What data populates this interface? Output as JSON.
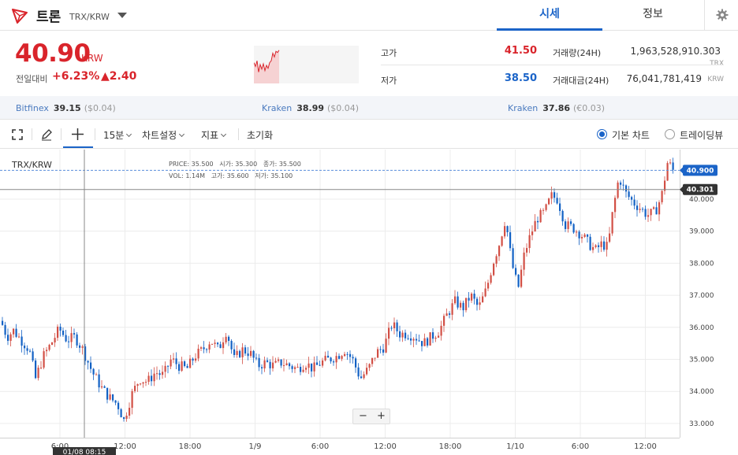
{
  "header": {
    "coin_name": "트론",
    "pair": "TRX/KRW",
    "tabs": [
      {
        "label": "시세",
        "active": true
      },
      {
        "label": "정보",
        "active": false
      }
    ]
  },
  "summary": {
    "price": "40.90",
    "unit": "KRW",
    "change_label": "전일대비",
    "change_rate": "+6.23%",
    "change_amount": "▲2.40",
    "high_label": "고가",
    "high": "41.50",
    "low_label": "저가",
    "low": "38.50",
    "volume_label": "거래량(24H)",
    "volume": "1,963,528,910.303",
    "volume_unit": "TRX",
    "value_label": "거래대금(24H)",
    "value": "76,041,781,419",
    "value_unit": "KRW"
  },
  "exchanges": [
    {
      "name": "Bitfinex",
      "price": "39.15",
      "sub": "($0.04)"
    },
    {
      "name": "Kraken",
      "price": "38.99",
      "sub": "($0.04)"
    },
    {
      "name": "Kraken",
      "price": "37.86",
      "sub": "(€0.03)"
    }
  ],
  "toolbar": {
    "interval": "15분",
    "settings": "차트설정",
    "indicators": "지표",
    "reset": "초기화",
    "basic_chart": "기본 차트",
    "tradingview": "트레이딩뷰"
  },
  "chart": {
    "pair_label": "TRX/KRW",
    "ohlc_row1": [
      "PRICE:",
      "35.500",
      "시가:",
      "35.300",
      "종가:",
      "35.500"
    ],
    "ohlc_row2": [
      "VOL:",
      "1.14M",
      "고가:",
      "35.600",
      "저가:",
      "35.100"
    ],
    "current_price_tag": "40.900",
    "crosshair_price_tag": "40.301",
    "crosshair_time_tag": "01/08 08:15",
    "zoom_out": "−",
    "zoom_in": "+",
    "colors": {
      "up": "#d24f45",
      "down": "#1261c4",
      "accent": "#1b64c8"
    }
  },
  "chart_data": {
    "type": "candlestick",
    "y_ticks": [
      "33.000",
      "34.000",
      "35.000",
      "36.000",
      "37.000",
      "38.000",
      "39.000",
      "40.000"
    ],
    "ylim": [
      32.85,
      41.35
    ],
    "x_ticks": [
      "6:00",
      "12:00",
      "18:00",
      "1/9",
      "6:00",
      "12:00",
      "18:00",
      "1/10",
      "6:00",
      "12:00"
    ],
    "current_price": 40.9,
    "crosshair_price": 40.301,
    "close_path": [
      [
        0,
        36.2
      ],
      [
        8,
        35.7
      ],
      [
        16,
        35.9
      ],
      [
        26,
        35.6
      ],
      [
        36,
        35.3
      ],
      [
        44,
        34.4
      ],
      [
        54,
        35.1
      ],
      [
        64,
        35.5
      ],
      [
        74,
        35.95
      ],
      [
        84,
        35.6
      ],
      [
        94,
        35.7
      ],
      [
        104,
        35.3
      ],
      [
        116,
        34.6
      ],
      [
        128,
        34.1
      ],
      [
        138,
        33.8
      ],
      [
        148,
        33.6
      ],
      [
        156,
        33.1
      ],
      [
        166,
        33.9
      ],
      [
        176,
        34.4
      ],
      [
        186,
        34.3
      ],
      [
        196,
        34.6
      ],
      [
        206,
        34.5
      ],
      [
        216,
        35.0
      ],
      [
        226,
        34.8
      ],
      [
        236,
        34.7
      ],
      [
        246,
        35.1
      ],
      [
        256,
        35.3
      ],
      [
        266,
        35.6
      ],
      [
        276,
        35.3
      ],
      [
        286,
        35.9
      ],
      [
        296,
        35.0
      ],
      [
        306,
        35.3
      ],
      [
        316,
        35.2
      ],
      [
        326,
        34.8
      ],
      [
        336,
        34.9
      ],
      [
        346,
        34.8
      ],
      [
        356,
        34.9
      ],
      [
        366,
        34.8
      ],
      [
        376,
        34.7
      ],
      [
        386,
        34.9
      ],
      [
        396,
        34.7
      ],
      [
        406,
        34.9
      ],
      [
        416,
        35.0
      ],
      [
        426,
        35.1
      ],
      [
        436,
        35.3
      ],
      [
        446,
        35.0
      ],
      [
        456,
        34.4
      ],
      [
        466,
        34.7
      ],
      [
        476,
        35.2
      ],
      [
        486,
        35.4
      ],
      [
        496,
        36.1
      ],
      [
        506,
        35.8
      ],
      [
        516,
        35.8
      ],
      [
        526,
        35.7
      ],
      [
        536,
        35.5
      ],
      [
        546,
        35.7
      ],
      [
        556,
        35.9
      ],
      [
        566,
        36.4
      ],
      [
        576,
        36.8
      ],
      [
        586,
        36.6
      ],
      [
        596,
        37.0
      ],
      [
        606,
        36.6
      ],
      [
        616,
        37.2
      ],
      [
        624,
        38.0
      ],
      [
        632,
        38.6
      ],
      [
        640,
        39.4
      ],
      [
        648,
        38.0
      ],
      [
        656,
        37.2
      ],
      [
        664,
        38.3
      ],
      [
        672,
        38.9
      ],
      [
        680,
        39.4
      ],
      [
        690,
        39.6
      ],
      [
        698,
        40.1
      ],
      [
        706,
        40.0
      ],
      [
        716,
        39.2
      ],
      [
        726,
        39.1
      ],
      [
        736,
        38.9
      ],
      [
        746,
        38.6
      ],
      [
        754,
        38.4
      ],
      [
        762,
        38.6
      ],
      [
        770,
        38.5
      ],
      [
        776,
        39.6
      ],
      [
        784,
        40.7
      ],
      [
        792,
        40.2
      ],
      [
        802,
        39.9
      ],
      [
        812,
        39.7
      ],
      [
        820,
        39.5
      ],
      [
        830,
        39.6
      ],
      [
        838,
        40.1
      ],
      [
        846,
        41.2
      ],
      [
        852,
        40.9
      ]
    ]
  }
}
